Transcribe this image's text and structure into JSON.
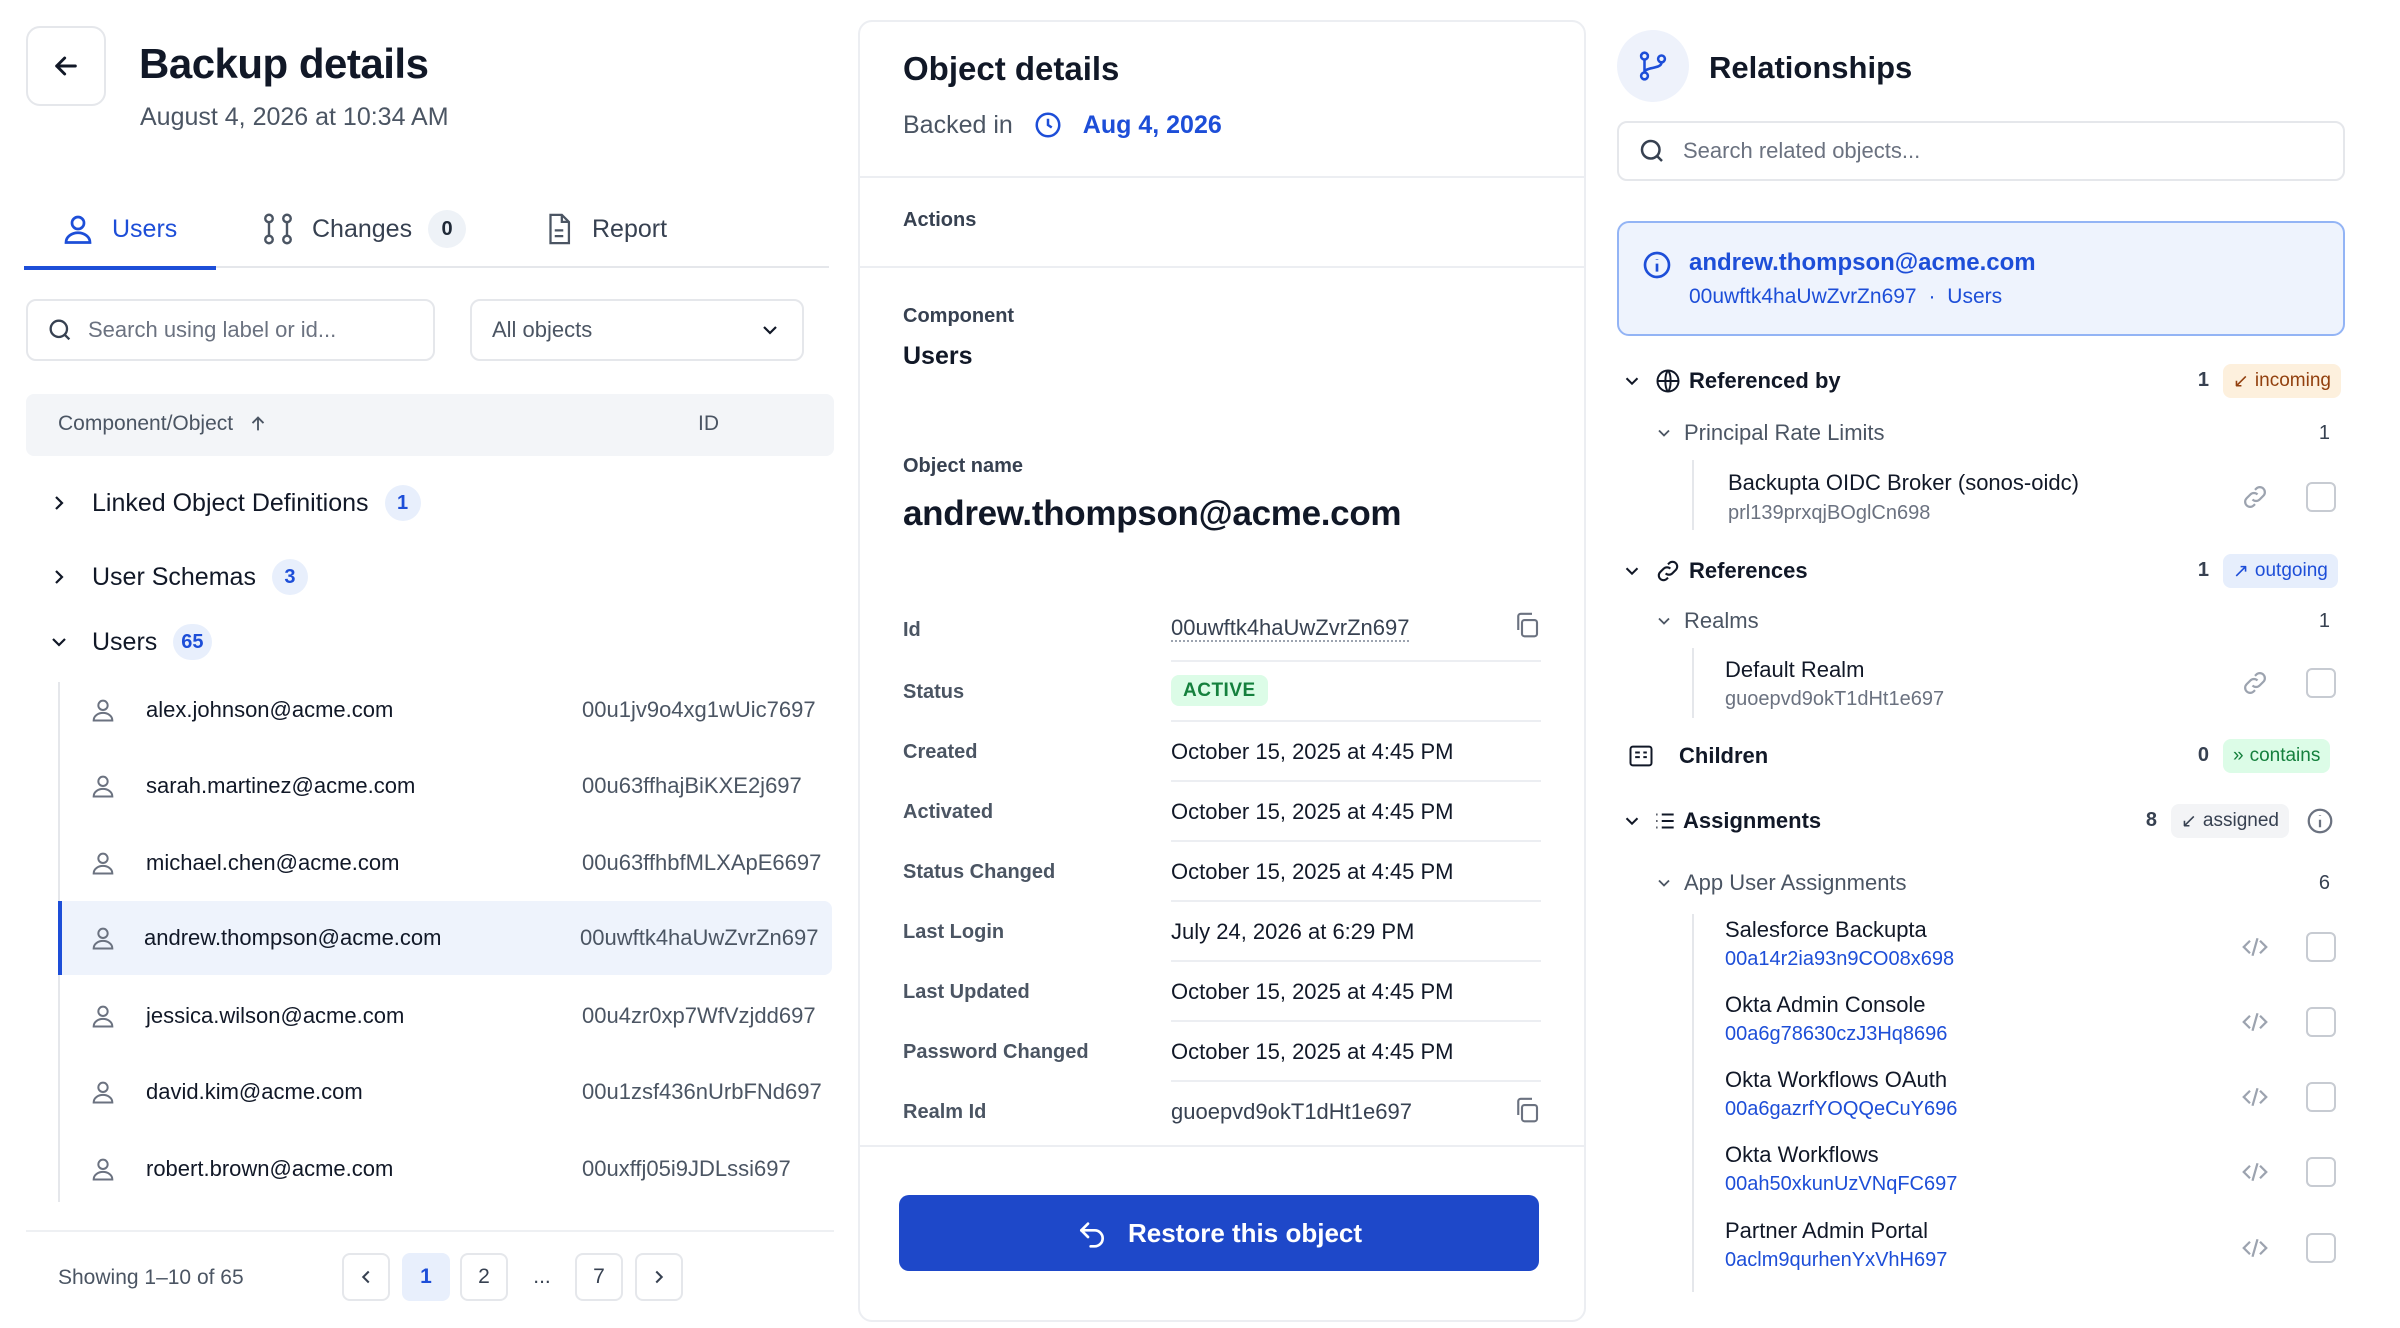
{
  "header": {
    "title": "Backup details",
    "subtitle": "August 4, 2026 at 10:34 AM"
  },
  "tabs": [
    {
      "label": "Users",
      "active": true
    },
    {
      "label": "Changes",
      "count": "0"
    },
    {
      "label": "Report"
    }
  ],
  "filters": {
    "search_placeholder": "Search using label or id...",
    "select_value": "All objects"
  },
  "table": {
    "col_component": "Component/Object",
    "col_id": "ID"
  },
  "groups": [
    {
      "label": "Linked Object Definitions",
      "count": "1",
      "expanded": false
    },
    {
      "label": "User Schemas",
      "count": "3",
      "expanded": false
    },
    {
      "label": "Users",
      "count": "65",
      "expanded": true
    }
  ],
  "users": [
    {
      "email": "alex.johnson@acme.com",
      "id": "00u1jv9o4xg1wUic7697"
    },
    {
      "email": "sarah.martinez@acme.com",
      "id": "00u63ffhajBiKXE2j697"
    },
    {
      "email": "michael.chen@acme.com",
      "id": "00u63ffhbfMLXApE6697"
    },
    {
      "email": "andrew.thompson@acme.com",
      "id": "00uwftk4haUwZvrZn697",
      "selected": true
    },
    {
      "email": "jessica.wilson@acme.com",
      "id": "00u4zr0xp7WfVzjdd697"
    },
    {
      "email": "david.kim@acme.com",
      "id": "00u1zsf436nUrbFNd697"
    },
    {
      "email": "robert.brown@acme.com",
      "id": "00uxffj05i9JDLssi697"
    }
  ],
  "pagination": {
    "showing": "Showing 1–10 of 65",
    "pages": [
      "1",
      "2",
      "...",
      "7"
    ],
    "current": "1"
  },
  "object_details": {
    "title": "Object details",
    "backed_in_label": "Backed in",
    "backed_in_date": "Aug 4, 2026",
    "actions_label": "Actions",
    "component_label": "Component",
    "component_value": "Users",
    "object_name_label": "Object name",
    "object_name_value": "andrew.thompson@acme.com",
    "fields": [
      {
        "label": "Id",
        "value": "00uwftk4haUwZvrZn697"
      },
      {
        "label": "Status",
        "value": "ACTIVE"
      },
      {
        "label": "Created",
        "value": "October 15, 2025 at 4:45 PM"
      },
      {
        "label": "Activated",
        "value": "October 15, 2025 at 4:45 PM"
      },
      {
        "label": "Status Changed",
        "value": "October 15, 2025 at 4:45 PM"
      },
      {
        "label": "Last Login",
        "value": "July 24, 2026 at 6:29 PM"
      },
      {
        "label": "Last Updated",
        "value": "October 15, 2025 at 4:45 PM"
      },
      {
        "label": "Password Changed",
        "value": "October 15, 2025 at 4:45 PM"
      },
      {
        "label": "Realm Id",
        "value": "guoepvd9okT1dHt1e697"
      }
    ],
    "restore_label": "Restore this object"
  },
  "relationships": {
    "title": "Relationships",
    "search_placeholder": "Search related objects...",
    "info": {
      "email": "andrew.thompson@acme.com",
      "id": "00uwftk4haUwZvrZn697",
      "separator": "·",
      "component": "Users"
    },
    "referenced_by": {
      "label": "Referenced by",
      "count": "1",
      "tag": "incoming",
      "sub": {
        "label": "Principal Rate Limits",
        "count": "1",
        "items": [
          {
            "name": "Backupta OIDC Broker (sonos-oidc)",
            "id": "prl139prxqjBOglCn698"
          }
        ]
      }
    },
    "references": {
      "label": "References",
      "count": "1",
      "tag": "outgoing",
      "sub": {
        "label": "Realms",
        "count": "1",
        "items": [
          {
            "name": "Default Realm",
            "id": "guoepvd9okT1dHt1e697"
          }
        ]
      }
    },
    "children": {
      "label": "Children",
      "count": "0",
      "tag": "contains"
    },
    "assignments": {
      "label": "Assignments",
      "count": "8",
      "tag": "assigned",
      "sub": {
        "label": "App User Assignments",
        "count": "6",
        "items": [
          {
            "name": "Salesforce Backupta",
            "id": "00a14r2ia93n9CO08x698"
          },
          {
            "name": "Okta Admin Console",
            "id": "00a6g78630czJ3Hq8696"
          },
          {
            "name": "Okta Workflows OAuth",
            "id": "00a6gazrfYOQQeCuY696"
          },
          {
            "name": "Okta Workflows",
            "id": "00ah50xkunUzVNqFC697"
          },
          {
            "name": "Partner Admin Portal",
            "id": "0aclm9qurhenYxVhH697"
          }
        ]
      }
    }
  },
  "colors": {
    "accent": "#1d4ed8",
    "button": "#1e48c9",
    "active_green": "#15803d",
    "incoming": "#92400e"
  }
}
